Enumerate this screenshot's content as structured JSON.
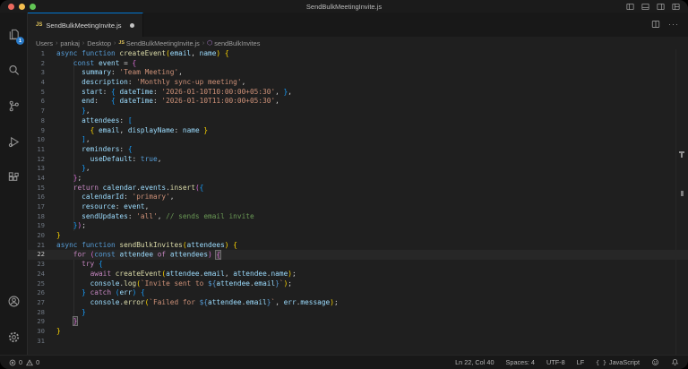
{
  "window": {
    "title": "SendBulkMeetingInvite.js"
  },
  "title_bar": {
    "icons": [
      "toggle-primary-sidebar-icon",
      "toggle-panel-icon",
      "toggle-secondary-sidebar-icon",
      "customize-layout-icon"
    ]
  },
  "activity_bar": {
    "badge": "1",
    "items": [
      "explorer-icon",
      "search-icon",
      "source-control-icon",
      "run-debug-icon",
      "extensions-icon",
      "account-icon",
      "settings-gear-icon"
    ]
  },
  "tab": {
    "label": "SendBulkMeetingInvite.js",
    "file_icon": "JS",
    "modified": true
  },
  "tab_actions": {
    "icons": [
      "split-editor-icon",
      "more-actions-icon"
    ],
    "more_label": "···"
  },
  "breadcrumbs": [
    {
      "label": "Users"
    },
    {
      "label": "pankaj"
    },
    {
      "label": "Desktop"
    },
    {
      "label": "SendBulkMeetingInvite.js",
      "icon": "js"
    },
    {
      "label": "sendBulkInvites",
      "icon": "symbol-method"
    }
  ],
  "editor": {
    "active_line": 22,
    "syntax_colors": {
      "keyword": "#569cd6",
      "control": "#c586c0",
      "function": "#dcdcaa",
      "variable": "#9cdcfe",
      "string": "#ce9178",
      "comment": "#6a9955",
      "punctuation": "#d4d4d4",
      "bracket1": "#ffd700",
      "bracket2": "#da70d6",
      "bracket3": "#179fff"
    },
    "lines": [
      {
        "n": 1,
        "tokens": [
          [
            "kw",
            "async function "
          ],
          [
            "fn",
            "createEvent"
          ],
          [
            "b1",
            "("
          ],
          [
            "va",
            "email"
          ],
          [
            "pu",
            ", "
          ],
          [
            "va",
            "name"
          ],
          [
            "b1",
            ")"
          ],
          [
            "pu",
            " "
          ],
          [
            "b1",
            "{"
          ]
        ]
      },
      {
        "n": 2,
        "tokens": [
          [
            "pu",
            "    "
          ],
          [
            "kw",
            "const "
          ],
          [
            "va",
            "event"
          ],
          [
            "pu",
            " = "
          ],
          [
            "b2",
            "{"
          ]
        ]
      },
      {
        "n": 3,
        "tokens": [
          [
            "pu",
            "      "
          ],
          [
            "va",
            "summary"
          ],
          [
            "pu",
            ": "
          ],
          [
            "st",
            "'Team Meeting'"
          ],
          [
            "pu",
            ","
          ]
        ]
      },
      {
        "n": 4,
        "tokens": [
          [
            "pu",
            "      "
          ],
          [
            "va",
            "description"
          ],
          [
            "pu",
            ": "
          ],
          [
            "st",
            "'Monthly sync-up meeting'"
          ],
          [
            "pu",
            ","
          ]
        ]
      },
      {
        "n": 5,
        "tokens": [
          [
            "pu",
            "      "
          ],
          [
            "va",
            "start"
          ],
          [
            "pu",
            ": "
          ],
          [
            "b3",
            "{"
          ],
          [
            "pu",
            " "
          ],
          [
            "va",
            "dateTime"
          ],
          [
            "pu",
            ": "
          ],
          [
            "st",
            "'2026-01-10T10:00:00+05:30'"
          ],
          [
            "pu",
            ", "
          ],
          [
            "b3",
            "}"
          ],
          [
            "pu",
            ","
          ]
        ]
      },
      {
        "n": 6,
        "tokens": [
          [
            "pu",
            "      "
          ],
          [
            "va",
            "end"
          ],
          [
            "pu",
            ":   "
          ],
          [
            "b3",
            "{"
          ],
          [
            "pu",
            " "
          ],
          [
            "va",
            "dateTime"
          ],
          [
            "pu",
            ": "
          ],
          [
            "st",
            "'2026-01-10T11:00:00+05:30'"
          ],
          [
            "pu",
            ","
          ]
        ]
      },
      {
        "n": 7,
        "tokens": [
          [
            "pu",
            "      "
          ],
          [
            "b3",
            "}"
          ],
          [
            "pu",
            ","
          ]
        ]
      },
      {
        "n": 8,
        "tokens": [
          [
            "pu",
            "      "
          ],
          [
            "va",
            "attendees"
          ],
          [
            "pu",
            ": "
          ],
          [
            "b3",
            "["
          ]
        ]
      },
      {
        "n": 9,
        "tokens": [
          [
            "pu",
            "        "
          ],
          [
            "b1",
            "{"
          ],
          [
            "pu",
            " "
          ],
          [
            "va",
            "email"
          ],
          [
            "pu",
            ", "
          ],
          [
            "va",
            "displayName"
          ],
          [
            "pu",
            ": "
          ],
          [
            "va",
            "name"
          ],
          [
            "pu",
            " "
          ],
          [
            "b1",
            "}"
          ]
        ]
      },
      {
        "n": 10,
        "tokens": [
          [
            "pu",
            "      "
          ],
          [
            "b3",
            "]"
          ],
          [
            "pu",
            ","
          ]
        ]
      },
      {
        "n": 11,
        "tokens": [
          [
            "pu",
            "      "
          ],
          [
            "va",
            "reminders"
          ],
          [
            "pu",
            ": "
          ],
          [
            "b3",
            "{"
          ]
        ]
      },
      {
        "n": 12,
        "tokens": [
          [
            "pu",
            "        "
          ],
          [
            "va",
            "useDefault"
          ],
          [
            "pu",
            ": "
          ],
          [
            "kw",
            "true"
          ],
          [
            "pu",
            ","
          ]
        ]
      },
      {
        "n": 13,
        "tokens": [
          [
            "pu",
            "      "
          ],
          [
            "b3",
            "}"
          ],
          [
            "pu",
            ","
          ]
        ]
      },
      {
        "n": 14,
        "tokens": [
          [
            "pu",
            "    "
          ],
          [
            "b2",
            "}"
          ],
          [
            "pu",
            ";"
          ]
        ]
      },
      {
        "n": 15,
        "tokens": [
          [
            "pu",
            "    "
          ],
          [
            "ct",
            "return "
          ],
          [
            "va",
            "calendar"
          ],
          [
            "pu",
            "."
          ],
          [
            "va",
            "events"
          ],
          [
            "pu",
            "."
          ],
          [
            "fn",
            "insert"
          ],
          [
            "b2",
            "("
          ],
          [
            "b3",
            "{"
          ]
        ]
      },
      {
        "n": 16,
        "tokens": [
          [
            "pu",
            "      "
          ],
          [
            "va",
            "calendarId"
          ],
          [
            "pu",
            ": "
          ],
          [
            "st",
            "'primary'"
          ],
          [
            "pu",
            ","
          ]
        ]
      },
      {
        "n": 17,
        "tokens": [
          [
            "pu",
            "      "
          ],
          [
            "va",
            "resource"
          ],
          [
            "pu",
            ": "
          ],
          [
            "va",
            "event"
          ],
          [
            "pu",
            ","
          ]
        ]
      },
      {
        "n": 18,
        "tokens": [
          [
            "pu",
            "      "
          ],
          [
            "va",
            "sendUpdates"
          ],
          [
            "pu",
            ": "
          ],
          [
            "st",
            "'all'"
          ],
          [
            "pu",
            ", "
          ],
          [
            "cm",
            "// sends email invite"
          ]
        ]
      },
      {
        "n": 19,
        "tokens": [
          [
            "pu",
            "    "
          ],
          [
            "b3",
            "}"
          ],
          [
            "b2",
            ")"
          ],
          [
            "pu",
            ";"
          ]
        ]
      },
      {
        "n": 20,
        "tokens": [
          [
            "b1",
            "}"
          ]
        ]
      },
      {
        "n": 21,
        "tokens": [
          [
            "kw",
            "async function "
          ],
          [
            "fn",
            "sendBulkInvites"
          ],
          [
            "b1",
            "("
          ],
          [
            "va",
            "attendees"
          ],
          [
            "b1",
            ")"
          ],
          [
            "pu",
            " "
          ],
          [
            "b1",
            "{"
          ]
        ]
      },
      {
        "n": 22,
        "caret": true,
        "tokens": [
          [
            "pu",
            "    "
          ],
          [
            "ct",
            "for"
          ],
          [
            "pu",
            " "
          ],
          [
            "b2",
            "("
          ],
          [
            "kw",
            "const"
          ],
          [
            "pu",
            " "
          ],
          [
            "va",
            "attendee"
          ],
          [
            "pu",
            " "
          ],
          [
            "ct",
            "of"
          ],
          [
            "pu",
            " "
          ],
          [
            "va",
            "attendees"
          ],
          [
            "b2",
            ")"
          ],
          [
            "pu",
            " "
          ],
          [
            "b2 bm",
            "{"
          ]
        ]
      },
      {
        "n": 23,
        "tokens": [
          [
            "pu",
            "      "
          ],
          [
            "ct",
            "try"
          ],
          [
            "pu",
            " "
          ],
          [
            "b3",
            "{"
          ]
        ]
      },
      {
        "n": 24,
        "tokens": [
          [
            "pu",
            "        "
          ],
          [
            "ct",
            "await "
          ],
          [
            "fn",
            "createEvent"
          ],
          [
            "b1",
            "("
          ],
          [
            "va",
            "attendee"
          ],
          [
            "pu",
            "."
          ],
          [
            "va",
            "email"
          ],
          [
            "pu",
            ", "
          ],
          [
            "va",
            "attendee"
          ],
          [
            "pu",
            "."
          ],
          [
            "va",
            "name"
          ],
          [
            "b1",
            ")"
          ],
          [
            "pu",
            ";"
          ]
        ]
      },
      {
        "n": 25,
        "tokens": [
          [
            "pu",
            "        "
          ],
          [
            "va",
            "console"
          ],
          [
            "pu",
            "."
          ],
          [
            "fn",
            "log"
          ],
          [
            "b1",
            "("
          ],
          [
            "st",
            "`Invite sent to "
          ],
          [
            "kw",
            "${"
          ],
          [
            "va",
            "attendee"
          ],
          [
            "pu",
            "."
          ],
          [
            "va",
            "email"
          ],
          [
            "kw",
            "}"
          ],
          [
            "st",
            "`"
          ],
          [
            "b1",
            ")"
          ],
          [
            "pu",
            ";"
          ]
        ]
      },
      {
        "n": 26,
        "tokens": [
          [
            "pu",
            "      "
          ],
          [
            "b3",
            "}"
          ],
          [
            "pu",
            " "
          ],
          [
            "ct",
            "catch"
          ],
          [
            "pu",
            " "
          ],
          [
            "b3",
            "("
          ],
          [
            "va",
            "err"
          ],
          [
            "b3",
            ")"
          ],
          [
            "pu",
            " "
          ],
          [
            "b3",
            "{"
          ]
        ]
      },
      {
        "n": 27,
        "tokens": [
          [
            "pu",
            "        "
          ],
          [
            "va",
            "console"
          ],
          [
            "pu",
            "."
          ],
          [
            "fn",
            "error"
          ],
          [
            "b1",
            "("
          ],
          [
            "st",
            "`Failed for "
          ],
          [
            "kw",
            "${"
          ],
          [
            "va",
            "attendee"
          ],
          [
            "pu",
            "."
          ],
          [
            "va",
            "email"
          ],
          [
            "kw",
            "}"
          ],
          [
            "st",
            "`"
          ],
          [
            "pu",
            ", "
          ],
          [
            "va",
            "err"
          ],
          [
            "pu",
            "."
          ],
          [
            "va",
            "message"
          ],
          [
            "b1",
            ")"
          ],
          [
            "pu",
            ";"
          ]
        ]
      },
      {
        "n": 28,
        "tokens": [
          [
            "pu",
            "      "
          ],
          [
            "b3",
            "}"
          ]
        ]
      },
      {
        "n": 29,
        "tokens": [
          [
            "pu",
            "    "
          ],
          [
            "b2 bm",
            "}"
          ]
        ]
      },
      {
        "n": 30,
        "tokens": [
          [
            "b1",
            "}"
          ]
        ]
      },
      {
        "n": 31,
        "tokens": []
      }
    ]
  },
  "status_bar": {
    "errors": "0",
    "warnings": "0",
    "cursor": "Ln 22, Col 40",
    "indentation": "Spaces: 4",
    "encoding": "UTF-8",
    "eol": "LF",
    "language_brace_glyph": "{ }",
    "language": "JavaScript",
    "icons": [
      "errors-icon",
      "warnings-icon",
      "feedback-icon",
      "notifications-bell-icon"
    ]
  }
}
